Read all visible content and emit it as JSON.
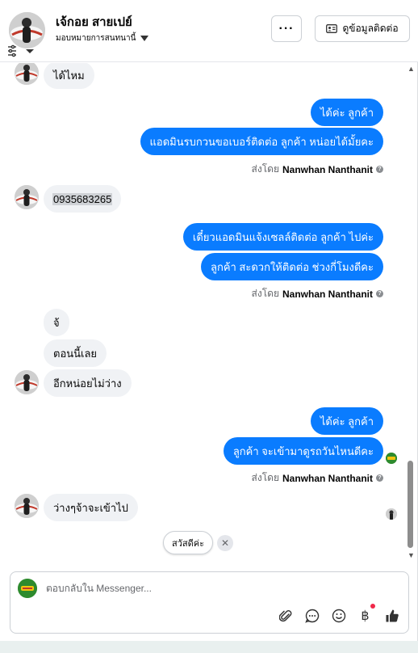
{
  "header": {
    "name": "เจ้กอย สายเปย์",
    "assign_label": "มอบหมายการสนทนานี้",
    "more_label": "···",
    "contact_label": "ดูข้อมูลติดต่อ"
  },
  "messages": {
    "m1": "ได้ไหม",
    "m2": "ได้ค่ะ  ลูกค้า",
    "m3": "แอดมินรบกวนขอเบอร์ติดต่อ ลูกค้า หน่อยได้มั้ยคะ",
    "m4": "0935683265",
    "m5": "เดี๋ยวแอดมินแจ้งเซลล์ติดต่อ ลูกค้า ไปค่ะ",
    "m6": "ลูกค้า สะดวกให้ติดต่อ ช่วงกี่โมงดีคะ",
    "m7": "จ้",
    "m8": "ตอนนี้เลย",
    "m9": "อีกหน่อยไม่ว่าง",
    "m10": "ได้ค่ะ  ลูกค้า",
    "m11": "ลูกค้า  จะเข้ามาดูรถวันไหนดีคะ",
    "m12": "ว่างๆจ้าจะเข้าไป"
  },
  "sent_by": {
    "prefix": "ส่งโดย",
    "agent": "Nanwhan Nanthanit"
  },
  "quick_reply": {
    "label": "สวัสดีค่ะ"
  },
  "composer": {
    "placeholder": "ตอบกลับใน Messenger..."
  },
  "colors": {
    "outgoing": "#0a7cff",
    "incoming": "#f0f2f5",
    "notify": "#f02849"
  },
  "icons": [
    "filter-icon",
    "chevron-down-icon",
    "more-icon",
    "contact-card-icon",
    "info-icon",
    "close-icon",
    "attachment-icon",
    "saved-reply-icon",
    "emoji-icon",
    "baht-icon",
    "like-icon"
  ]
}
